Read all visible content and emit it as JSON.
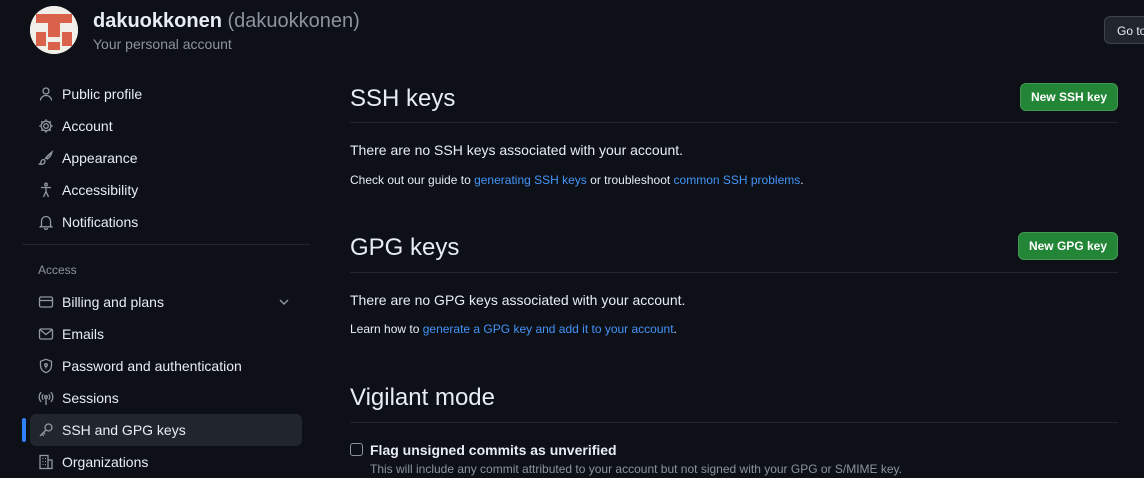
{
  "header": {
    "display_name": "dakuokkonen",
    "login": "(dakuokkonen)",
    "subtitle": "Your personal account",
    "goto_button": "Go to your personal profile"
  },
  "sidebar": {
    "items": [
      {
        "label": "Public profile",
        "icon": "person-icon"
      },
      {
        "label": "Account",
        "icon": "gear-icon"
      },
      {
        "label": "Appearance",
        "icon": "paintbrush-icon"
      },
      {
        "label": "Accessibility",
        "icon": "accessibility-icon"
      },
      {
        "label": "Notifications",
        "icon": "bell-icon"
      }
    ],
    "access_heading": "Access",
    "access_items": [
      {
        "label": "Billing and plans",
        "icon": "credit-card-icon"
      },
      {
        "label": "Emails",
        "icon": "mail-icon"
      },
      {
        "label": "Password and authentication",
        "icon": "shield-lock-icon"
      },
      {
        "label": "Sessions",
        "icon": "broadcast-icon"
      },
      {
        "label": "SSH and GPG keys",
        "icon": "key-icon",
        "active": true
      },
      {
        "label": "Organizations",
        "icon": "organization-icon"
      }
    ]
  },
  "ssh": {
    "title": "SSH keys",
    "new_button": "New SSH key",
    "empty": "There are no SSH keys associated with your account.",
    "guide_prefix": "Check out our guide to ",
    "guide_link1": "generating SSH keys",
    "guide_mid": " or troubleshoot ",
    "guide_link2": "common SSH problems",
    "guide_suffix": "."
  },
  "gpg": {
    "title": "GPG keys",
    "new_button": "New GPG key",
    "empty": "There are no GPG keys associated with your account.",
    "learn_prefix": "Learn how to ",
    "learn_link": "generate a GPG key and add it to your account",
    "learn_suffix": "."
  },
  "vigilant": {
    "title": "Vigilant mode",
    "checkbox_label": "Flag unsigned commits as unverified",
    "checkbox_checked": false,
    "hint": "This will include any commit attributed to your account but not signed with your GPG or S/MIME key."
  },
  "colors": {
    "accent": "#2f81f7",
    "link": "#4493f8",
    "primary_button": "#238636",
    "background": "#0d1117"
  }
}
